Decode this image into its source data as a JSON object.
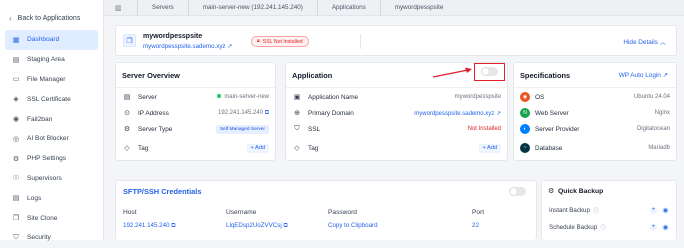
{
  "sidebar": {
    "back_label": "Back to Applications",
    "items": [
      {
        "label": "Dashboard",
        "icon": "dashboard-icon",
        "active": true
      },
      {
        "label": "Staging Area",
        "icon": "staging-icon"
      },
      {
        "label": "File Manager",
        "icon": "file-icon"
      },
      {
        "label": "SSL Certificate",
        "icon": "ssl-icon"
      },
      {
        "label": "Fail2ban",
        "icon": "fail2ban-icon"
      },
      {
        "label": "AI Bot Blocker",
        "icon": "bot-icon"
      },
      {
        "label": "PHP Settings",
        "icon": "php-icon"
      },
      {
        "label": "Supervisors",
        "icon": "supervisor-icon"
      },
      {
        "label": "Logs",
        "icon": "logs-icon"
      },
      {
        "label": "Site Clone",
        "icon": "clone-icon"
      },
      {
        "label": "Security",
        "icon": "security-icon"
      }
    ]
  },
  "breadcrumb": [
    "Servers",
    "main-server-new (192.241.145.240)",
    "Applications",
    "mywordpesspsite"
  ],
  "site": {
    "name": "mywordpesspsite",
    "url": "mywordpesspsite.sademo.xyz",
    "ssl_status": "SSL Not Installed",
    "hide_details": "Hide Details"
  },
  "overview": {
    "title": "Server Overview",
    "server_label": "Server",
    "server_value": "main-server-new",
    "ip_label": "IP Address",
    "ip_value": "192.241.145.240",
    "type_label": "Server Type",
    "type_value": "Self Managed Server",
    "tag_label": "Tag",
    "add_label": "+ Add"
  },
  "application": {
    "title": "Application",
    "name_label": "Application Name",
    "name_value": "mywordpesspsite",
    "domain_label": "Primary Domain",
    "domain_value": "mywordpesspsite.sademo.xyz",
    "ssl_label": "SSL",
    "ssl_value": "Not Installed",
    "tag_label": "Tag",
    "add_label": "+ Add",
    "toggle_on": false
  },
  "specs": {
    "title": "Specifications",
    "auto_login": "WP Auto Login",
    "rows": [
      {
        "label": "OS",
        "value": "Ubuntu 24.04"
      },
      {
        "label": "Web Server",
        "value": "Nginx"
      },
      {
        "label": "Server Provider",
        "value": "Digitalocean"
      },
      {
        "label": "Database",
        "value": "Mariadb"
      }
    ]
  },
  "credentials": {
    "title": "SFTP/SSH Credentials",
    "host_label": "Host",
    "host_value": "192.241.145.240",
    "user_label": "Username",
    "user_value": "LlqEDsp2UoZVVCsj",
    "pass_label": "Password",
    "pass_value": "Copy to Clipboard",
    "port_label": "Port",
    "port_value": "22"
  },
  "backup": {
    "title": "Quick Backup",
    "instant": "Instant Backup",
    "schedule": "Schedule Backup"
  },
  "colors": {
    "accent": "#2563eb",
    "danger": "#dc2626",
    "success": "#22c55e"
  }
}
